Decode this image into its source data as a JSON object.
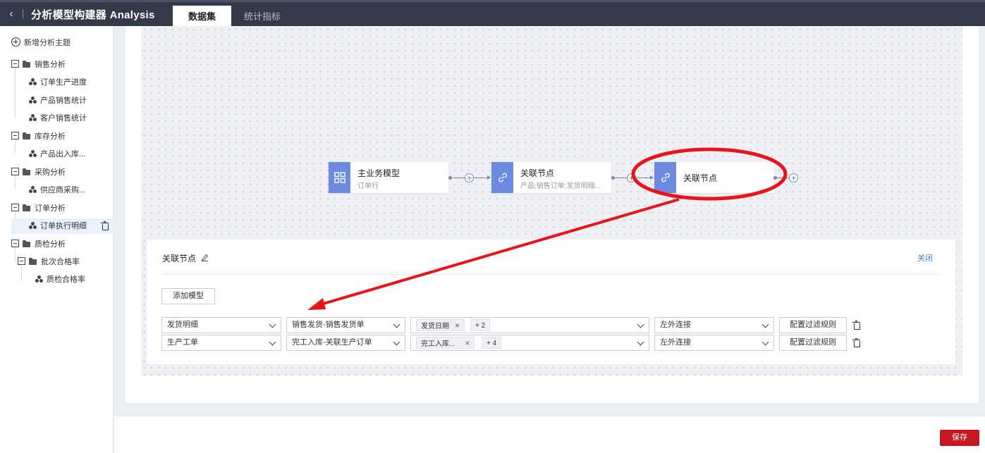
{
  "header": {
    "back_icon": "chevron-left-icon",
    "title": "分析模型构建器 Analysis",
    "tabs": [
      {
        "label": "数据集",
        "active": true
      },
      {
        "label": "统计指标",
        "active": false
      }
    ]
  },
  "sidebar": {
    "add_topic": "新增分析主题",
    "groups": [
      {
        "label": "销售分析",
        "items": [
          "订单生产进度",
          "产品销售统计",
          "客户销售统计"
        ]
      },
      {
        "label": "库存分析",
        "items": [
          "产品出入库..."
        ]
      },
      {
        "label": "采购分析",
        "items": [
          "供应商采购..."
        ]
      },
      {
        "label": "订单分析",
        "items": [
          "订单执行明细"
        ],
        "selected_item": "订单执行明细"
      },
      {
        "label": "质检分析",
        "subgroup": {
          "label": "批次合格率",
          "items": [
            "质检合格率"
          ]
        }
      }
    ]
  },
  "canvas": {
    "nodes": [
      {
        "title": "主业务模型",
        "subtitle": "订单行",
        "icon": "grid-model-icon"
      },
      {
        "title": "关联节点",
        "subtitle": "产品;销售订单;发货明细...",
        "icon": "link-icon"
      },
      {
        "title": "关联节点",
        "subtitle": "",
        "icon": "link-icon"
      }
    ]
  },
  "detail": {
    "title": "关联节点",
    "edit_icon": "pencil-icon",
    "close_label": "关闭",
    "add_model_label": "添加模型",
    "rows": [
      {
        "model": "发货明细",
        "relation": "销售发货-销售发货单",
        "fields": [
          "发货日期"
        ],
        "more": "+ 2",
        "join": "左外连接",
        "filter_label": "配置过滤规则"
      },
      {
        "model": "生产工单",
        "relation": "完工入库-关联生产订单",
        "fields": [
          "完工入库..."
        ],
        "more": "+ 4",
        "join": "左外连接",
        "filter_label": "配置过滤规则"
      }
    ]
  },
  "footer": {
    "save_label": "保存"
  },
  "colors": {
    "topbar": "#343a47",
    "node_icon": "#6b8ae0",
    "save": "#c3191f",
    "link": "#3b7bd4",
    "annotation": "#e8141b"
  }
}
